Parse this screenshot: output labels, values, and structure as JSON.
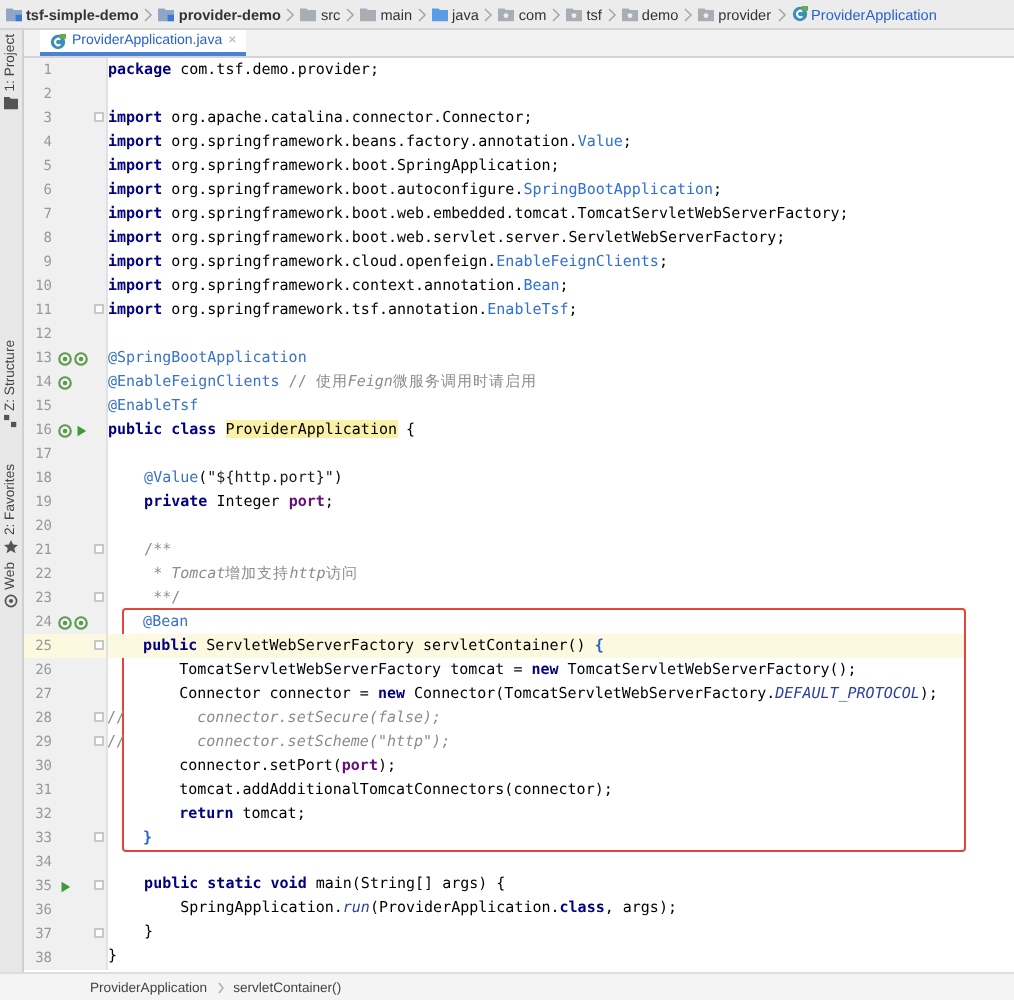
{
  "breadcrumbs": [
    {
      "label": "tsf-simple-demo",
      "kind": "module"
    },
    {
      "label": "provider-demo",
      "kind": "module"
    },
    {
      "label": "src",
      "kind": "folder"
    },
    {
      "label": "main",
      "kind": "folder"
    },
    {
      "label": "java",
      "kind": "source"
    },
    {
      "label": "com",
      "kind": "package"
    },
    {
      "label": "tsf",
      "kind": "package"
    },
    {
      "label": "demo",
      "kind": "package"
    },
    {
      "label": "provider",
      "kind": "package"
    },
    {
      "label": "ProviderApplication",
      "kind": "class"
    }
  ],
  "side_tools": [
    {
      "label": "1: Project",
      "kind": "folder"
    },
    {
      "label": "Z: Structure",
      "kind": "structure"
    },
    {
      "label": "2: Favorites",
      "kind": "star"
    },
    {
      "label": "Web",
      "kind": "web"
    }
  ],
  "tabs": [
    {
      "label": "ProviderApplication.java",
      "close": "×",
      "selected": true
    }
  ],
  "lines": [
    {
      "number": "1",
      "current": false,
      "boxed": false,
      "fold": false,
      "tokens": [
        {
          "kind": "kw",
          "text": "package"
        },
        {
          "kind": "plain",
          "text": " com.tsf.demo.provider;"
        }
      ]
    },
    {
      "number": "2",
      "current": false,
      "boxed": false,
      "fold": false
    },
    {
      "number": "3",
      "current": false,
      "boxed": false,
      "fold": true,
      "tokens": [
        {
          "kind": "kw",
          "text": "import"
        },
        {
          "kind": "plain",
          "text": " org.apache.catalina.connector.Connector;"
        }
      ]
    },
    {
      "number": "4",
      "current": false,
      "boxed": false,
      "fold": false,
      "tokens": [
        {
          "kind": "kw",
          "text": "import"
        },
        {
          "kind": "plain",
          "text": " org.springframework.beans.factory.annotation."
        },
        {
          "kind": "ref",
          "text": "Value"
        },
        {
          "kind": "plain",
          "text": ";"
        }
      ]
    },
    {
      "number": "5",
      "current": false,
      "boxed": false,
      "fold": false,
      "tokens": [
        {
          "kind": "kw",
          "text": "import"
        },
        {
          "kind": "plain",
          "text": " org.springframework.boot.SpringApplication;"
        }
      ]
    },
    {
      "number": "6",
      "current": false,
      "boxed": false,
      "fold": false,
      "tokens": [
        {
          "kind": "kw",
          "text": "import"
        },
        {
          "kind": "plain",
          "text": " org.springframework.boot.autoconfigure."
        },
        {
          "kind": "ref",
          "text": "SpringBootApplication"
        },
        {
          "kind": "plain",
          "text": ";"
        }
      ]
    },
    {
      "number": "7",
      "current": false,
      "boxed": false,
      "fold": false,
      "tokens": [
        {
          "kind": "kw",
          "text": "import"
        },
        {
          "kind": "plain",
          "text": " org.springframework.boot.web.embedded.tomcat.TomcatServletWebServerFactory;"
        }
      ]
    },
    {
      "number": "8",
      "current": false,
      "boxed": false,
      "fold": false,
      "tokens": [
        {
          "kind": "kw",
          "text": "import"
        },
        {
          "kind": "plain",
          "text": " org.springframework.boot.web.servlet.server.ServletWebServerFactory;"
        }
      ]
    },
    {
      "number": "9",
      "current": false,
      "boxed": false,
      "fold": false,
      "tokens": [
        {
          "kind": "kw",
          "text": "import"
        },
        {
          "kind": "plain",
          "text": " org.springframework.cloud.openfeign."
        },
        {
          "kind": "ref",
          "text": "EnableFeignClients"
        },
        {
          "kind": "plain",
          "text": ";"
        }
      ]
    },
    {
      "number": "10",
      "current": false,
      "boxed": false,
      "fold": false,
      "tokens": [
        {
          "kind": "kw",
          "text": "import"
        },
        {
          "kind": "plain",
          "text": " org.springframework.context.annotation."
        },
        {
          "kind": "ref",
          "text": "Bean"
        },
        {
          "kind": "plain",
          "text": ";"
        }
      ]
    },
    {
      "number": "11",
      "current": false,
      "boxed": false,
      "fold": true,
      "tokens": [
        {
          "kind": "kw",
          "text": "import"
        },
        {
          "kind": "plain",
          "text": " org.springframework.tsf.annotation."
        },
        {
          "kind": "ref",
          "text": "EnableTsf"
        },
        {
          "kind": "plain",
          "text": ";"
        }
      ]
    },
    {
      "number": "12",
      "current": false,
      "boxed": false,
      "fold": false
    },
    {
      "number": "13",
      "current": false,
      "boxed": false,
      "fold": false,
      "gutter_icons": [
        {
          "kind": "bean"
        },
        {
          "kind": "bean"
        }
      ],
      "tokens": [
        {
          "kind": "ann",
          "text": "@SpringBootApplication"
        }
      ]
    },
    {
      "number": "14",
      "current": false,
      "boxed": false,
      "fold": false,
      "gutter_icons": [
        {
          "kind": "bean"
        }
      ],
      "tokens": [
        {
          "kind": "ann",
          "text": "@EnableFeignClients"
        },
        {
          "kind": "comment",
          "text": " // 使用"
        },
        {
          "kind": "comment-italic",
          "text": "Feign"
        },
        {
          "kind": "comment",
          "text": "微服务调用时请启用"
        }
      ]
    },
    {
      "number": "15",
      "current": false,
      "boxed": false,
      "fold": false,
      "tokens": [
        {
          "kind": "ann",
          "text": "@EnableTsf"
        }
      ]
    },
    {
      "number": "16",
      "current": false,
      "boxed": false,
      "fold": false,
      "gutter_icons": [
        {
          "kind": "bean"
        },
        {
          "kind": "run"
        }
      ],
      "tokens": [
        {
          "kind": "kw",
          "text": "public class "
        },
        {
          "kind": "highlight",
          "text": "ProviderApplication"
        },
        {
          "kind": "plain",
          "text": " {"
        }
      ]
    },
    {
      "number": "17",
      "current": false,
      "boxed": false,
      "fold": false
    },
    {
      "number": "18",
      "current": false,
      "boxed": false,
      "fold": false,
      "tokens": [
        {
          "kind": "ann",
          "text": "    @Value"
        },
        {
          "kind": "plain",
          "text": "("
        },
        {
          "kind": "str",
          "text": "\"${http.port}\""
        },
        {
          "kind": "plain",
          "text": ")"
        }
      ]
    },
    {
      "number": "19",
      "current": false,
      "boxed": false,
      "fold": false,
      "tokens": [
        {
          "kind": "kw",
          "text": "    private "
        },
        {
          "kind": "plain",
          "text": "Integer "
        },
        {
          "kind": "field",
          "text": "port"
        },
        {
          "kind": "plain",
          "text": ";"
        }
      ]
    },
    {
      "number": "20",
      "current": false,
      "boxed": false,
      "fold": false
    },
    {
      "number": "21",
      "current": false,
      "boxed": false,
      "fold": true,
      "tokens": [
        {
          "kind": "comment",
          "text": "    /**"
        }
      ]
    },
    {
      "number": "22",
      "current": false,
      "boxed": false,
      "fold": false,
      "tokens": [
        {
          "kind": "comment",
          "text": "     * "
        },
        {
          "kind": "comment-italic",
          "text": "Tomcat"
        },
        {
          "kind": "comment",
          "text": "增加支持"
        },
        {
          "kind": "comment-italic",
          "text": "http"
        },
        {
          "kind": "comment",
          "text": "访问"
        }
      ]
    },
    {
      "number": "23",
      "current": false,
      "boxed": false,
      "fold": true,
      "tokens": [
        {
          "kind": "comment",
          "text": "     **/"
        }
      ]
    },
    {
      "number": "24",
      "current": false,
      "boxed": true,
      "fold": false,
      "gutter_icons": [
        {
          "kind": "bean"
        },
        {
          "kind": "bean"
        }
      ],
      "tokens": [
        {
          "kind": "ann",
          "text": "    @Bean"
        }
      ]
    },
    {
      "number": "25",
      "current": true,
      "boxed": true,
      "fold": true,
      "tokens": [
        {
          "kind": "kw",
          "text": "    public "
        },
        {
          "kind": "plain",
          "text": "ServletWebServerFactory servletContainer() "
        },
        {
          "kind": "brace",
          "text": "{"
        }
      ]
    },
    {
      "number": "26",
      "current": false,
      "boxed": true,
      "fold": false,
      "tokens": [
        {
          "kind": "plain",
          "text": "        TomcatServletWebServerFactory tomcat = "
        },
        {
          "kind": "kw",
          "text": "new "
        },
        {
          "kind": "plain",
          "text": "TomcatServletWebServerFactory();"
        }
      ]
    },
    {
      "number": "27",
      "current": false,
      "boxed": true,
      "fold": false,
      "tokens": [
        {
          "kind": "plain",
          "text": "        Connector connector = "
        },
        {
          "kind": "kw",
          "text": "new "
        },
        {
          "kind": "plain",
          "text": "Connector(TomcatServletWebServerFactory."
        },
        {
          "kind": "static",
          "text": "DEFAULT_PROTOCOL"
        },
        {
          "kind": "plain",
          "text": ");"
        }
      ]
    },
    {
      "number": "28",
      "current": false,
      "boxed": true,
      "fold": true,
      "tokens": [
        {
          "kind": "comment",
          "text": "//"
        },
        {
          "kind": "comment-italic",
          "text": "        connector.setSecure(false);"
        }
      ]
    },
    {
      "number": "29",
      "current": false,
      "boxed": true,
      "fold": true,
      "tokens": [
        {
          "kind": "comment",
          "text": "//"
        },
        {
          "kind": "comment-italic",
          "text": "        connector.setScheme(\"http\");"
        }
      ]
    },
    {
      "number": "30",
      "current": false,
      "boxed": true,
      "fold": false,
      "tokens": [
        {
          "kind": "plain",
          "text": "        connector.setPort("
        },
        {
          "kind": "field",
          "text": "port"
        },
        {
          "kind": "plain",
          "text": ");"
        }
      ]
    },
    {
      "number": "31",
      "current": false,
      "boxed": true,
      "fold": false,
      "tokens": [
        {
          "kind": "plain",
          "text": "        tomcat.addAdditionalTomcatConnectors(connector);"
        }
      ]
    },
    {
      "number": "32",
      "current": false,
      "boxed": true,
      "fold": false,
      "tokens": [
        {
          "kind": "kw",
          "text": "        return "
        },
        {
          "kind": "plain",
          "text": "tomcat;"
        }
      ]
    },
    {
      "number": "33",
      "current": false,
      "boxed": true,
      "fold": true,
      "tokens": [
        {
          "kind": "brace",
          "text": "    }"
        }
      ]
    },
    {
      "number": "34",
      "current": false,
      "boxed": false,
      "fold": false
    },
    {
      "number": "35",
      "current": false,
      "boxed": false,
      "fold": true,
      "gutter_icons": [
        {
          "kind": "run"
        }
      ],
      "tokens": [
        {
          "kind": "kw",
          "text": "    public static void "
        },
        {
          "kind": "plain",
          "text": "main(String[] args) {"
        }
      ]
    },
    {
      "number": "36",
      "current": false,
      "boxed": false,
      "fold": false,
      "tokens": [
        {
          "kind": "plain",
          "text": "        SpringApplication."
        },
        {
          "kind": "static",
          "text": "run"
        },
        {
          "kind": "plain",
          "text": "(ProviderApplication."
        },
        {
          "kind": "kw",
          "text": "class"
        },
        {
          "kind": "plain",
          "text": ", args);"
        }
      ]
    },
    {
      "number": "37",
      "current": false,
      "boxed": false,
      "fold": true,
      "tokens": [
        {
          "kind": "plain",
          "text": "    }"
        }
      ]
    },
    {
      "number": "38",
      "current": false,
      "boxed": false,
      "fold": false,
      "tokens": [
        {
          "kind": "plain",
          "text": "}"
        }
      ]
    }
  ],
  "status_breadcrumbs": [
    "ProviderApplication",
    "servletContainer()"
  ]
}
